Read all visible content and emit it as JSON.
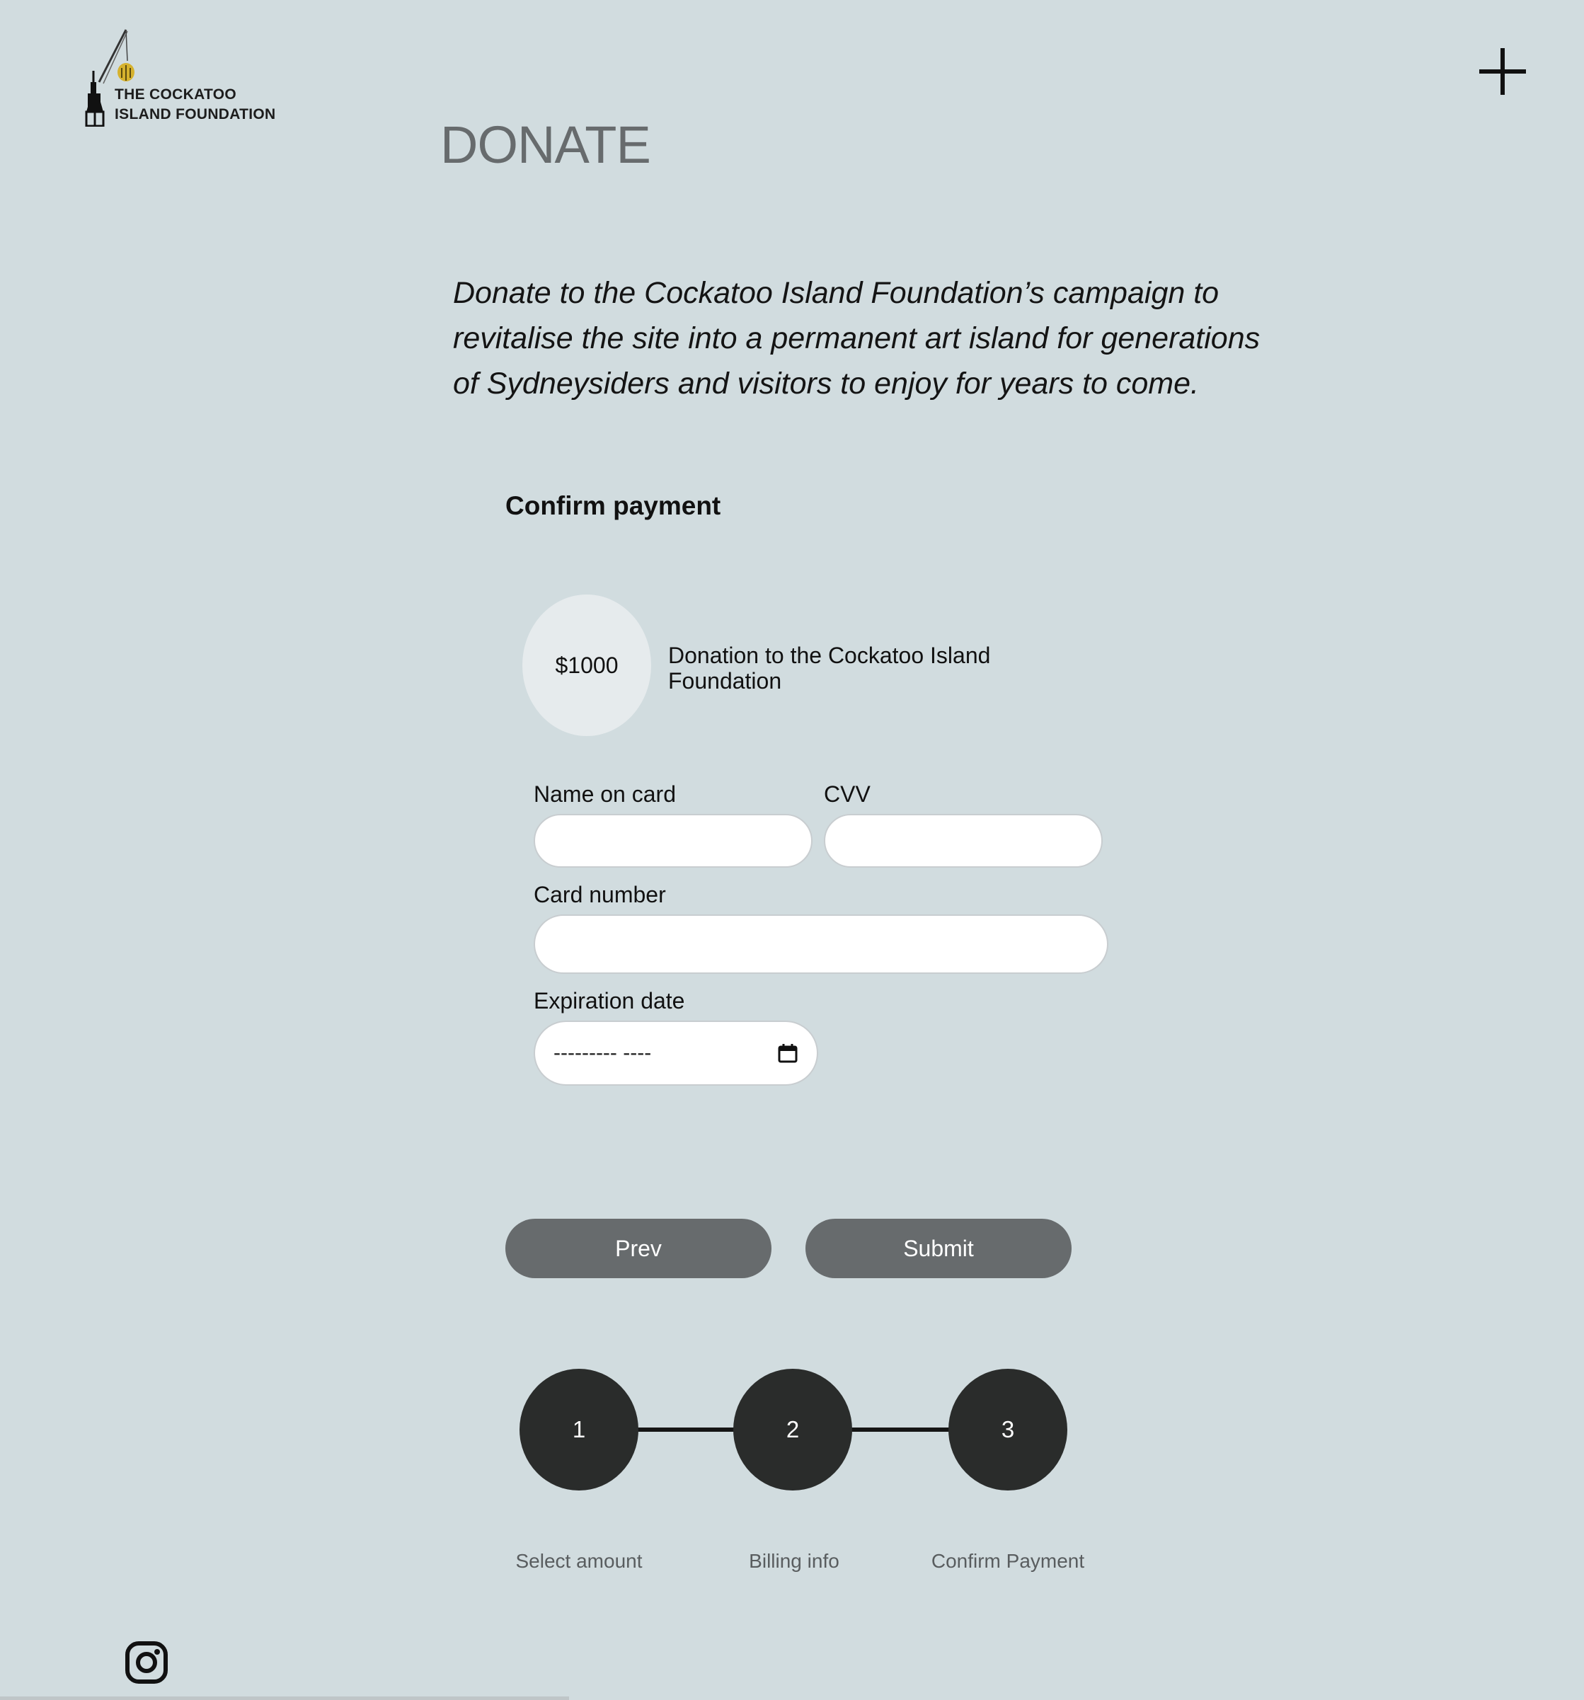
{
  "brand": {
    "line1": "THE COCKATOO",
    "line2": "ISLAND FOUNDATION",
    "logo_icon": "crane-logo-icon",
    "accent_color": "#d6b22e"
  },
  "header": {
    "menu_icon": "plus-icon"
  },
  "page": {
    "title": "DONATE",
    "intro": "Donate to the Cockatoo Island Foundation’s campaign to revitalise the site into a permanent art island for generations of Sydneysiders and visitors to enjoy for years to come."
  },
  "payment": {
    "heading": "Confirm payment",
    "amount": "$1000",
    "description": "Donation to the Cockatoo Island Foundation"
  },
  "form": {
    "name_label": "Name on card",
    "name_value": "",
    "cvv_label": "CVV",
    "cvv_value": "",
    "card_label": "Card number",
    "card_value": "",
    "expiry_label": "Expiration date",
    "expiry_placeholder": "--------- ----",
    "expiry_icon": "calendar-icon"
  },
  "actions": {
    "prev_label": "Prev",
    "submit_label": "Submit"
  },
  "stepper": {
    "steps": [
      {
        "number": "1",
        "label": "Select amount"
      },
      {
        "number": "2",
        "label": "Billing info"
      },
      {
        "number": "3",
        "label": "Confirm Payment"
      }
    ]
  },
  "footer": {
    "social_icon": "instagram-icon"
  },
  "colors": {
    "background": "#d1dcdf",
    "button": "#676b6d",
    "step_circle": "#2a2c2b"
  }
}
